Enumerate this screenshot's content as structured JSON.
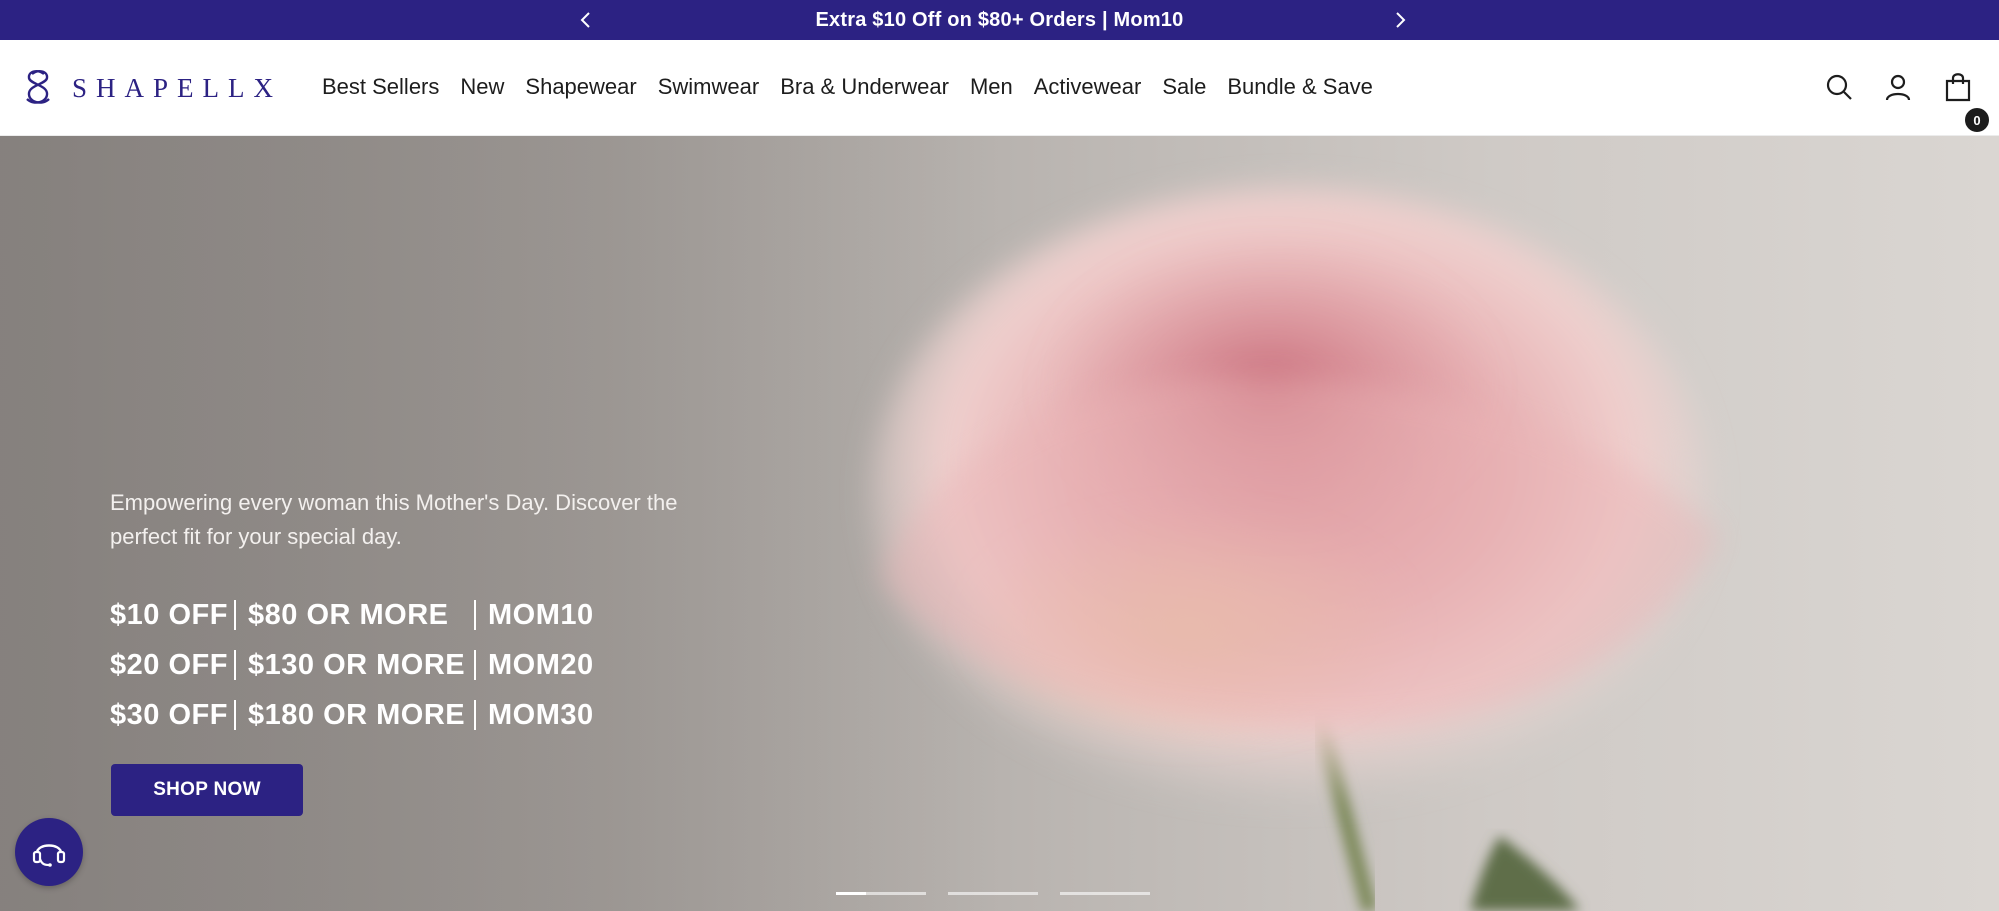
{
  "announcement": {
    "text": "Extra $10 Off on $80+ Orders | Mom10",
    "prev_icon": "chevron-left-icon",
    "next_icon": "chevron-right-icon"
  },
  "header": {
    "logo_text": "SHAPELLX",
    "nav": [
      "Best Sellers",
      "New",
      "Shapewear",
      "Swimwear",
      "Bra & Underwear",
      "Men",
      "Activewear",
      "Sale",
      "Bundle & Save"
    ],
    "icons": [
      "search-icon",
      "account-icon",
      "cart-icon"
    ],
    "cart_count": "0"
  },
  "hero": {
    "subtitle": "Empowering every woman this Mother's Day. Discover the perfect fit for your special day.",
    "offers": [
      {
        "discount": "$10 OFF",
        "threshold": "$80 OR MORE",
        "code": "MOM10"
      },
      {
        "discount": "$20 OFF",
        "threshold": "$130 OR MORE",
        "code": "MOM20"
      },
      {
        "discount": "$30 OFF",
        "threshold": "$180 OR MORE",
        "code": "MOM30"
      }
    ],
    "cta_label": "SHOP NOW",
    "slides_total": 3,
    "active_slide": 1
  },
  "chat": {
    "icon": "headset-icon"
  },
  "colors": {
    "brand": "#2c2283",
    "text": "#1d1d1d",
    "white": "#ffffff"
  }
}
